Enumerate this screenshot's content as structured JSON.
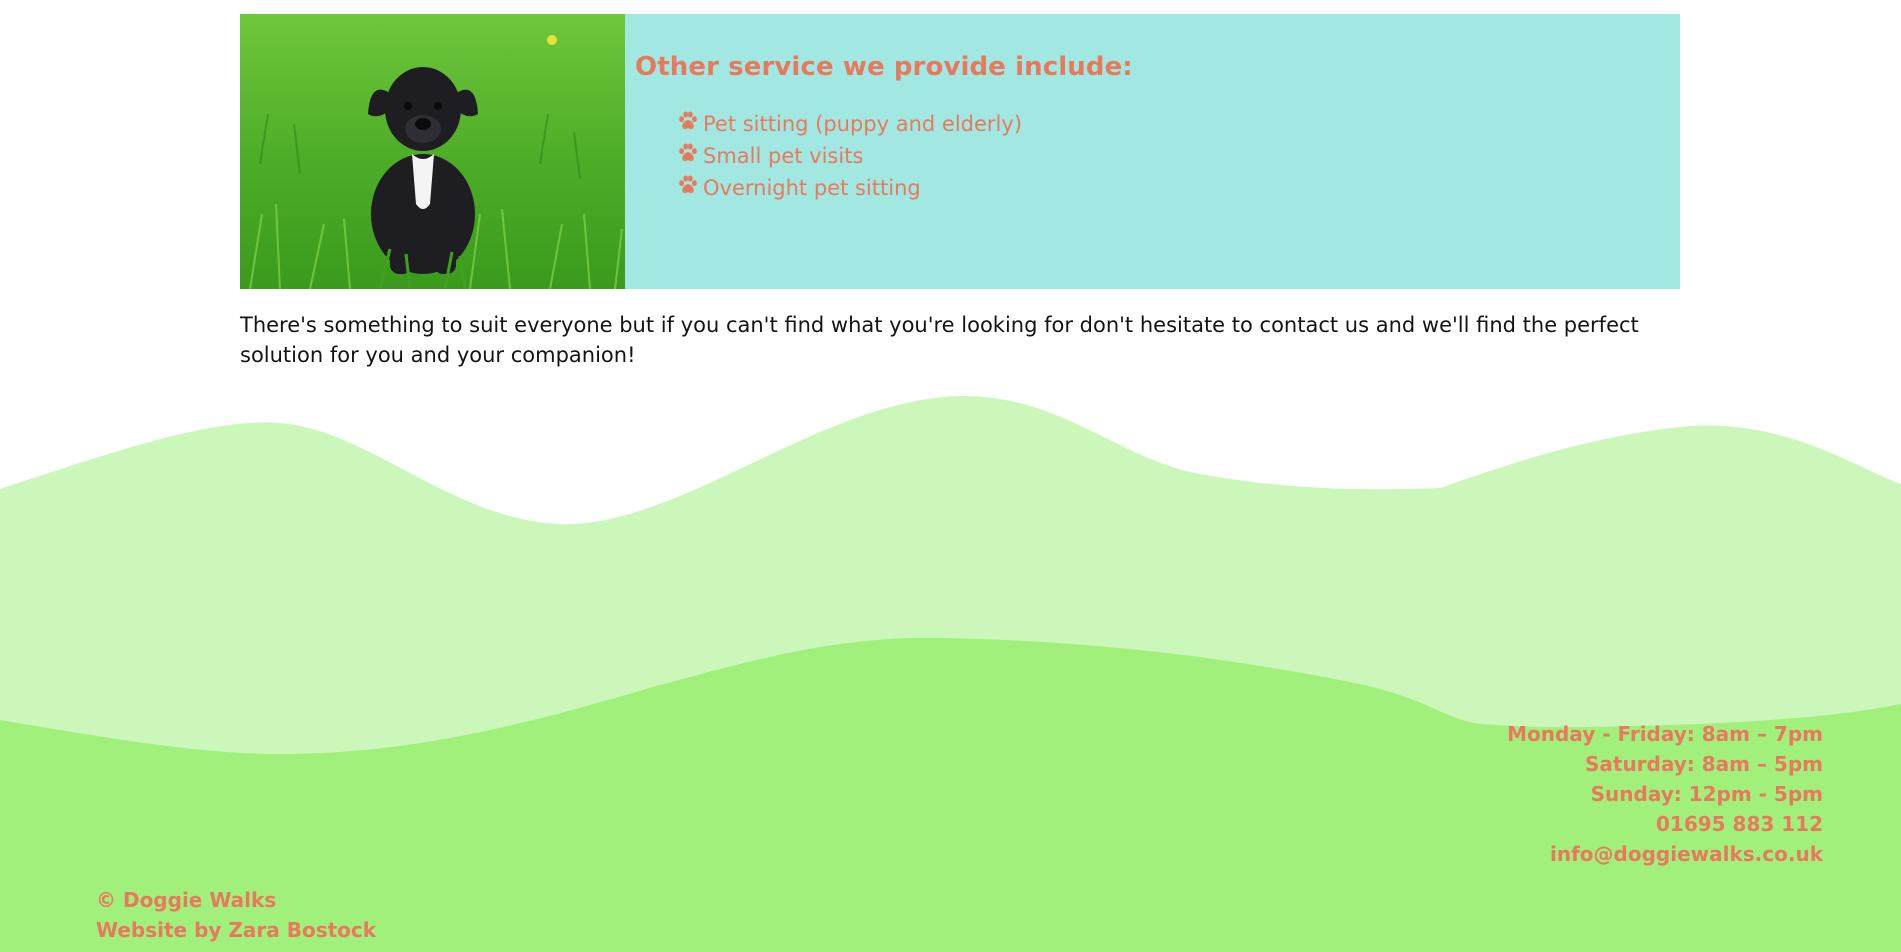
{
  "services": {
    "title": "Other service we provide include:",
    "items": [
      "Pet sitting (puppy and elderly)",
      "Small pet visits",
      "Overnight pet sitting"
    ]
  },
  "intro": {
    "text": "There's something to suit everyone but if you can't find what you're looking for don't hesitate to contact us and we'll find the perfect solution for you and your companion!"
  },
  "footer": {
    "hours": [
      "Monday - Friday: 8am – 7pm",
      "Saturday: 8am – 5pm",
      "Sunday: 12pm - 5pm"
    ],
    "phone": "01695 883 112",
    "email": "info@doggiewalks.co.uk",
    "copyright": "© Doggie Walks",
    "credit": "Website by Zara Bostock"
  },
  "colors": {
    "accent": "#e9795c",
    "panel": "#a1e8e3",
    "hill_light": "#ccf7bb",
    "hill_dark": "#a2f07c"
  },
  "icons": {
    "list_bullet": "paw-icon",
    "photo": "black-puppy-on-grass"
  }
}
